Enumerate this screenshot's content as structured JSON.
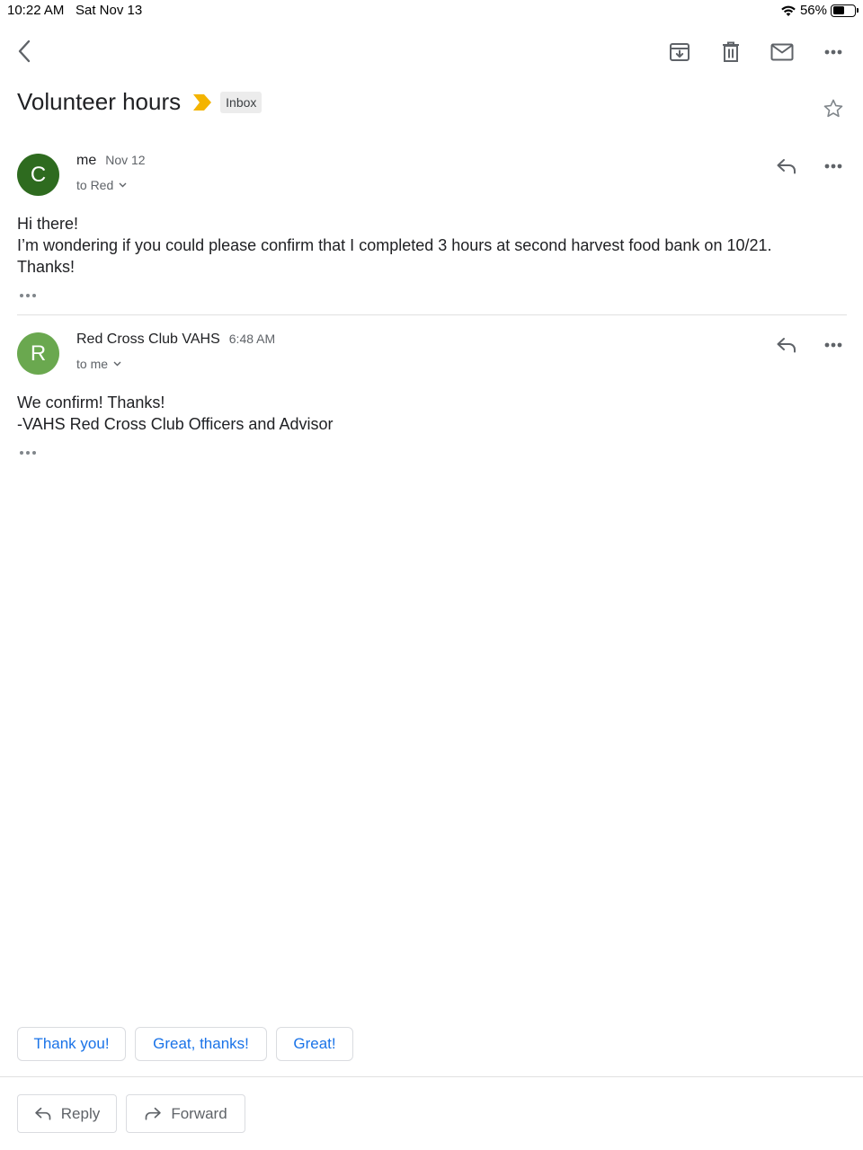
{
  "status_bar": {
    "time": "10:22 AM",
    "date": "Sat Nov 13",
    "battery": "56%",
    "battery_level": 0.56
  },
  "toolbar": {
    "back_icon": "chevron-left-icon",
    "archive_icon": "archive-icon",
    "delete_icon": "trash-icon",
    "mark_unread_icon": "mail-icon",
    "more_icon": "more-horizontal-icon"
  },
  "thread": {
    "subject": "Volunteer hours",
    "label": "Inbox",
    "importance_color": "#F4B400"
  },
  "messages": [
    {
      "avatar_letter": "C",
      "avatar_color": "#2E6B1F",
      "sender": "me",
      "time": "Nov 12",
      "recipients": "to Red",
      "body": [
        "Hi there!",
        "I’m wondering if you could please confirm that I completed 3 hours at second harvest food bank on 10/21. Thanks!"
      ]
    },
    {
      "avatar_letter": "R",
      "avatar_color": "#6AA84F",
      "sender": "Red Cross Club VAHS",
      "time": "6:48 AM",
      "recipients": "to me",
      "body": [
        "We confirm! Thanks!",
        "-VAHS Red Cross Club Officers and Advisor"
      ]
    }
  ],
  "smart_replies": [
    "Thank you!",
    "Great, thanks!",
    "Great!"
  ],
  "actions": {
    "reply": "Reply",
    "forward": "Forward"
  },
  "colors": {
    "accent_blue": "#1A73E8",
    "text_primary": "#202124",
    "text_secondary": "#5F6368"
  }
}
